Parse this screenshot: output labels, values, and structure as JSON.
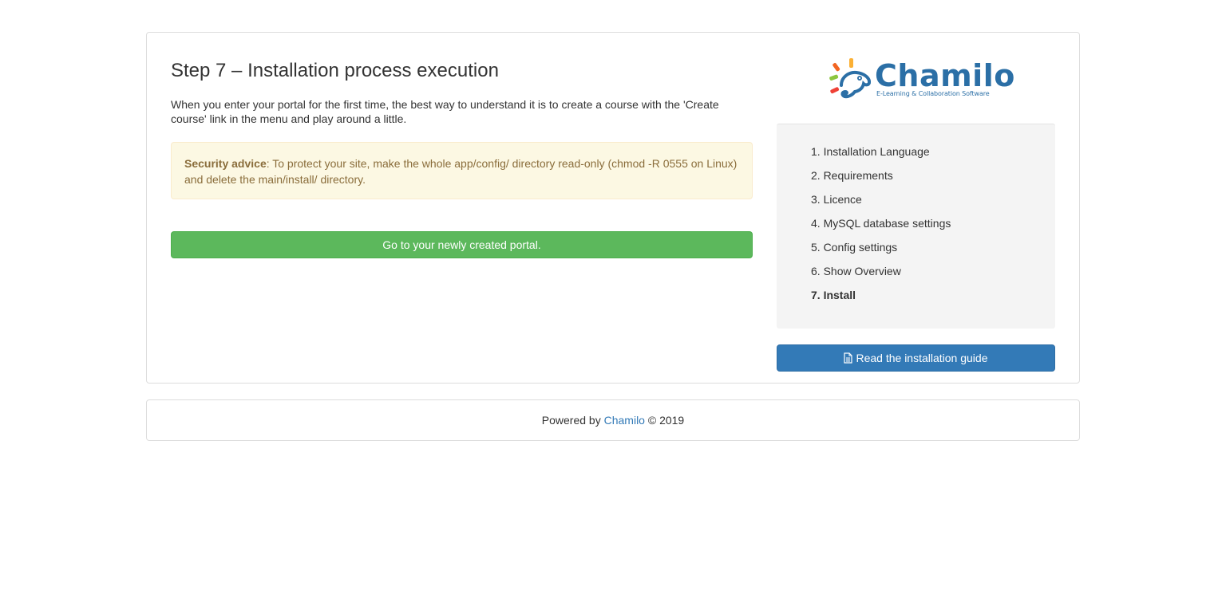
{
  "main": {
    "title": "Step 7 – Installation process execution",
    "intro": "When you enter your portal for the first time, the best way to understand it is to create a course with the 'Create course' link in the menu and play around a little.",
    "alert": {
      "label": "Security advice",
      "text": ": To protect your site, make the whole app/config/ directory read-only (chmod -R 0555 on Linux) and delete the main/install/ directory."
    },
    "go_button_label": "Go to your newly created portal."
  },
  "sidebar": {
    "logo": {
      "name": "Chamilo",
      "tagline": "E-Learning & Collaboration Software",
      "colors": [
        "#f26522",
        "#fbb034",
        "#8dc63f",
        "#ef4136",
        "#2b6fa6"
      ]
    },
    "steps": [
      {
        "label": "1. Installation Language"
      },
      {
        "label": "2. Requirements"
      },
      {
        "label": "3. Licence"
      },
      {
        "label": "4. MySQL database settings"
      },
      {
        "label": "5. Config settings"
      },
      {
        "label": "6. Show Overview"
      },
      {
        "label": "7. Install",
        "active": true
      }
    ],
    "guide_button_label": "Read the installation guide",
    "guide_button_icon": "file-text-icon"
  },
  "footer": {
    "prefix": "Powered by ",
    "link": "Chamilo",
    "suffix": " © 2019"
  },
  "colors": {
    "success": "#5cb85c",
    "primary": "#337ab7",
    "warning_bg": "#fcf8e3",
    "warning_text": "#8a6d3b"
  }
}
